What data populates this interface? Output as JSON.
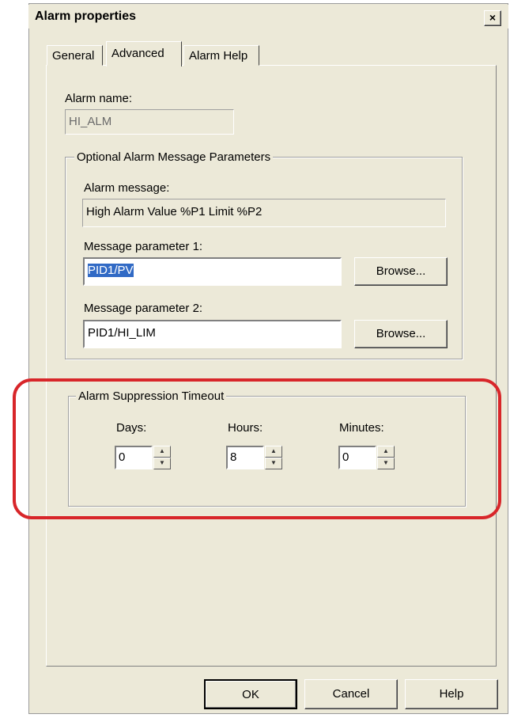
{
  "window": {
    "title": "Alarm properties",
    "close_glyph": "×"
  },
  "tabs": [
    {
      "label": "General",
      "selected": false
    },
    {
      "label": "Advanced",
      "selected": true
    },
    {
      "label": "Alarm Help",
      "selected": false
    }
  ],
  "alarm_name": {
    "label": "Alarm name:",
    "value": "HI_ALM"
  },
  "optional_group": {
    "legend": "Optional Alarm Message Parameters",
    "alarm_message": {
      "label": "Alarm message:",
      "value": "High Alarm Value %P1 Limit %P2"
    },
    "param1": {
      "label": "Message parameter 1:",
      "value": "PID1/PV"
    },
    "param2": {
      "label": "Message parameter 2:",
      "value": "PID1/HI_LIM"
    },
    "browse_label": "Browse..."
  },
  "suppression_group": {
    "legend": "Alarm Suppression Timeout",
    "days": {
      "label": "Days:",
      "value": "0"
    },
    "hours": {
      "label": "Hours:",
      "value": "8"
    },
    "minutes": {
      "label": "Minutes:",
      "value": "0"
    }
  },
  "buttons": {
    "ok": "OK",
    "cancel": "Cancel",
    "help": "Help"
  },
  "colors": {
    "dialog_bg": "#ece9d8",
    "highlight": "#d8262a",
    "selection": "#316ac5"
  }
}
